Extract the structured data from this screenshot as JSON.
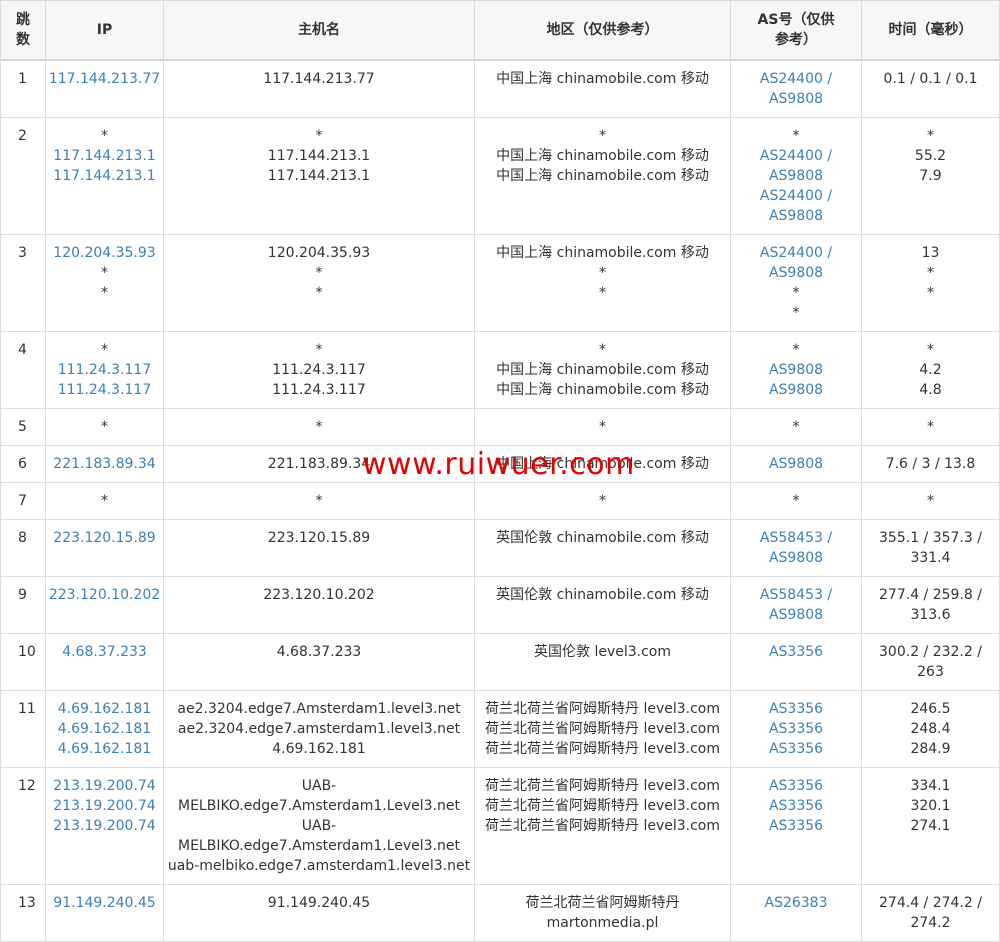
{
  "headers": {
    "hop": "跳数",
    "ip": "IP",
    "hostname": "主机名",
    "region": "地区（仅供参考）",
    "as": "AS号（仅供参考）",
    "time": "时间（毫秒）"
  },
  "rows": [
    {
      "hop": "1",
      "ip": [
        "117.144.213.77"
      ],
      "host": [
        "117.144.213.77"
      ],
      "region": [
        "中国上海 chinamobile.com 移动"
      ],
      "as": [
        "AS24400 /",
        "AS9808"
      ],
      "time": [
        "0.1 / 0.1 / 0.1"
      ]
    },
    {
      "hop": "2",
      "ip": [
        "*",
        "117.144.213.1",
        "117.144.213.1"
      ],
      "host": [
        "*",
        "117.144.213.1",
        "117.144.213.1"
      ],
      "region": [
        "*",
        "中国上海 chinamobile.com 移动",
        "中国上海 chinamobile.com 移动"
      ],
      "as": [
        "*",
        "AS24400 /",
        "AS9808",
        "AS24400 /",
        "AS9808"
      ],
      "time": [
        "*",
        "55.2",
        "7.9"
      ]
    },
    {
      "hop": "3",
      "ip": [
        "120.204.35.93",
        "*",
        "*"
      ],
      "host": [
        "120.204.35.93",
        "*",
        "*"
      ],
      "region": [
        "中国上海 chinamobile.com 移动",
        "*",
        "*"
      ],
      "as": [
        "AS24400 /",
        "AS9808",
        "*",
        "*"
      ],
      "time": [
        "13",
        "*",
        "*"
      ]
    },
    {
      "hop": "4",
      "ip": [
        "*",
        "111.24.3.117",
        "111.24.3.117"
      ],
      "host": [
        "*",
        "111.24.3.117",
        "111.24.3.117"
      ],
      "region": [
        "*",
        "中国上海 chinamobile.com 移动",
        "中国上海 chinamobile.com 移动"
      ],
      "as": [
        "*",
        "AS9808",
        "AS9808"
      ],
      "time": [
        "*",
        "4.2",
        "4.8"
      ]
    },
    {
      "hop": "5",
      "ip": [
        "*"
      ],
      "host": [
        "*"
      ],
      "region": [
        "*"
      ],
      "as": [
        "*"
      ],
      "time": [
        "*"
      ]
    },
    {
      "hop": "6",
      "ip": [
        "221.183.89.34"
      ],
      "host": [
        "221.183.89.34"
      ],
      "region": [
        "中国上海 chinamobile.com 移动"
      ],
      "as": [
        "AS9808"
      ],
      "time": [
        "7.6 / 3 / 13.8"
      ]
    },
    {
      "hop": "7",
      "ip": [
        "*"
      ],
      "host": [
        "*"
      ],
      "region": [
        "*"
      ],
      "as": [
        "*"
      ],
      "time": [
        "*"
      ]
    },
    {
      "hop": "8",
      "ip": [
        "223.120.15.89"
      ],
      "host": [
        "223.120.15.89"
      ],
      "region": [
        "英国伦敦 chinamobile.com 移动"
      ],
      "as": [
        "AS58453 /",
        "AS9808"
      ],
      "time": [
        "355.1 / 357.3 /",
        "331.4"
      ]
    },
    {
      "hop": "9",
      "ip": [
        "223.120.10.202"
      ],
      "host": [
        "223.120.10.202"
      ],
      "region": [
        "英国伦敦 chinamobile.com 移动"
      ],
      "as": [
        "AS58453 /",
        "AS9808"
      ],
      "time": [
        "277.4 / 259.8 /",
        "313.6"
      ]
    },
    {
      "hop": "10",
      "ip": [
        "4.68.37.233"
      ],
      "host": [
        "4.68.37.233"
      ],
      "region": [
        "英国伦敦 level3.com"
      ],
      "as": [
        "AS3356"
      ],
      "time": [
        "300.2 / 232.2 /",
        "263"
      ]
    },
    {
      "hop": "11",
      "ip": [
        "4.69.162.181",
        "4.69.162.181",
        "4.69.162.181"
      ],
      "host": [
        "ae2.3204.edge7.Amsterdam1.level3.net",
        "ae2.3204.edge7.amsterdam1.level3.net",
        "4.69.162.181"
      ],
      "region": [
        "荷兰北荷兰省阿姆斯特丹 level3.com",
        "荷兰北荷兰省阿姆斯特丹 level3.com",
        "荷兰北荷兰省阿姆斯特丹 level3.com"
      ],
      "as": [
        "AS3356",
        "AS3356",
        "AS3356"
      ],
      "time": [
        "246.5",
        "248.4",
        "284.9"
      ]
    },
    {
      "hop": "12",
      "ip": [
        "213.19.200.74",
        "213.19.200.74",
        "213.19.200.74"
      ],
      "host": [
        "UAB-",
        "MELBIKO.edge7.Amsterdam1.Level3.net",
        "UAB-",
        "MELBIKO.edge7.Amsterdam1.Level3.net",
        "uab-melbiko.edge7.amsterdam1.level3.net"
      ],
      "region": [
        "荷兰北荷兰省阿姆斯特丹 level3.com",
        "荷兰北荷兰省阿姆斯特丹 level3.com",
        "荷兰北荷兰省阿姆斯特丹 level3.com"
      ],
      "as": [
        "AS3356",
        "AS3356",
        "AS3356"
      ],
      "time": [
        "334.1",
        "320.1",
        "274.1"
      ]
    },
    {
      "hop": "13",
      "ip": [
        "91.149.240.45"
      ],
      "host": [
        "91.149.240.45"
      ],
      "region": [
        "荷兰北荷兰省阿姆斯特丹",
        "martonmedia.pl"
      ],
      "as": [
        "AS26383"
      ],
      "time": [
        "274.4 / 274.2 /",
        "274.2"
      ]
    }
  ],
  "watermark": "www.ruiwuer.com",
  "colors": {
    "link": "#3c7fb8",
    "watermark": "#e40000",
    "border": "#dcdcdc",
    "header_bg": "#f7f7f7"
  }
}
